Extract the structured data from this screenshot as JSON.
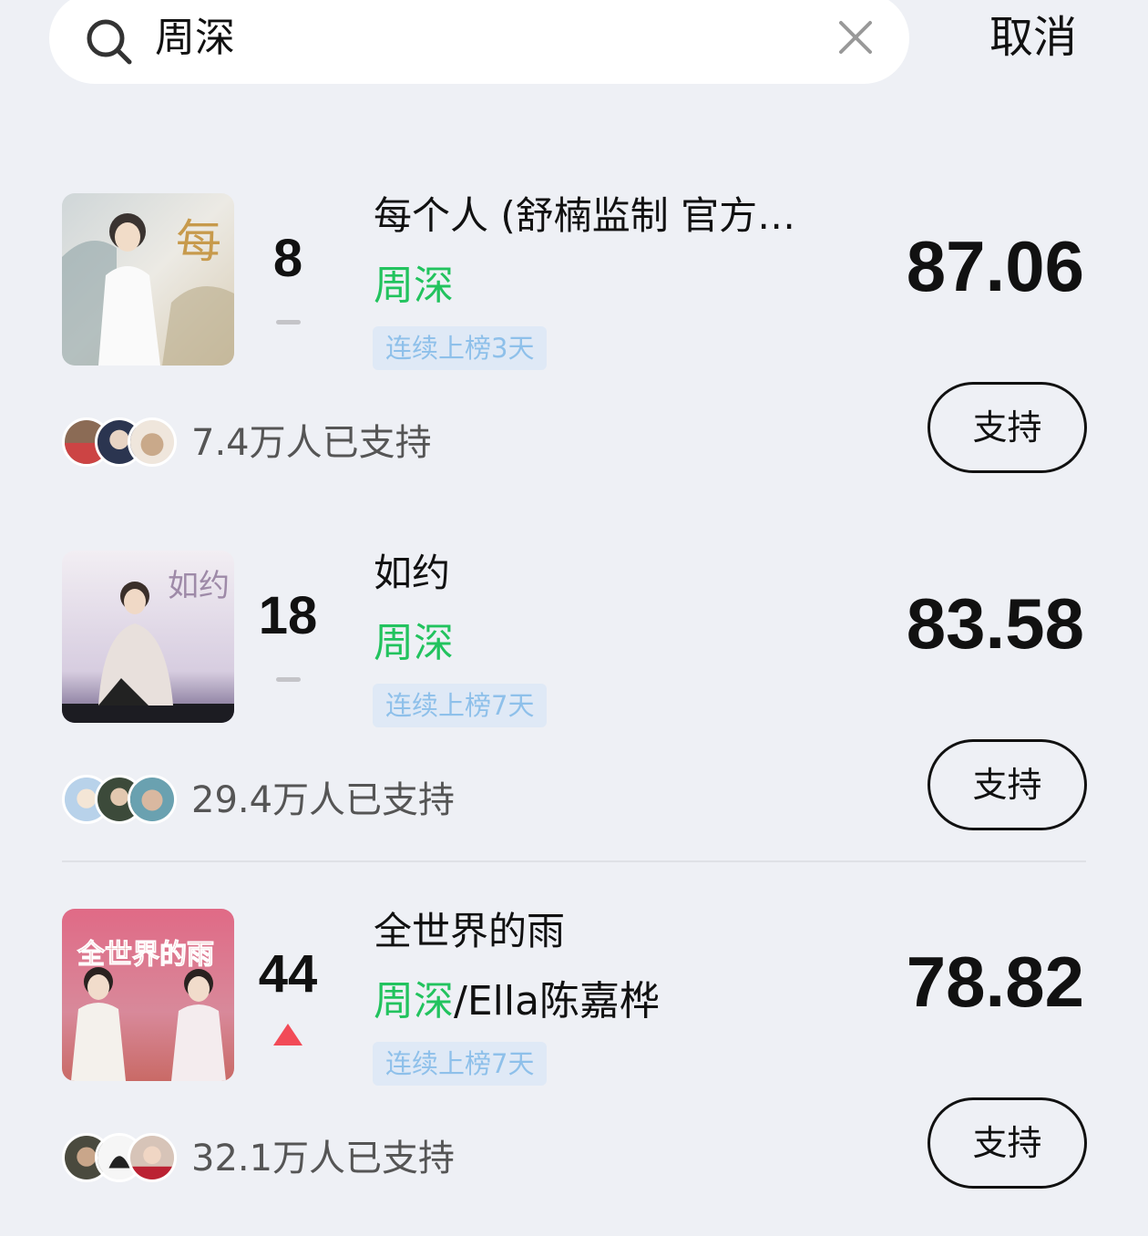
{
  "search": {
    "query": "周深",
    "cancel_label": "取消"
  },
  "entries": [
    {
      "rank": "8",
      "trend": "flat",
      "title": "每个人 (舒楠监制 官方…",
      "artist_primary": "周深",
      "artist_rest": "",
      "streak": "连续上榜3天",
      "score": "87.06",
      "supporters": "7.4万人已支持",
      "support_label": "支持",
      "cover_text": "每"
    },
    {
      "rank": "18",
      "trend": "flat",
      "title": "如约",
      "artist_primary": "周深",
      "artist_rest": "",
      "streak": "连续上榜7天",
      "score": "83.58",
      "supporters": "29.4万人已支持",
      "support_label": "支持",
      "cover_text": "如约"
    },
    {
      "rank": "44",
      "trend": "up",
      "title": "全世界的雨",
      "artist_primary": "周深",
      "artist_rest": "/Ella陈嘉桦",
      "streak": "连续上榜7天",
      "score": "78.82",
      "supporters": "32.1万人已支持",
      "support_label": "支持",
      "cover_text": "全世界的雨"
    }
  ],
  "colors": {
    "background": "#eef0f5",
    "artist_green": "#22c35e",
    "badge_bg": "#dfe9f6",
    "badge_text": "#8ec0ea",
    "trend_up": "#f24b57"
  }
}
